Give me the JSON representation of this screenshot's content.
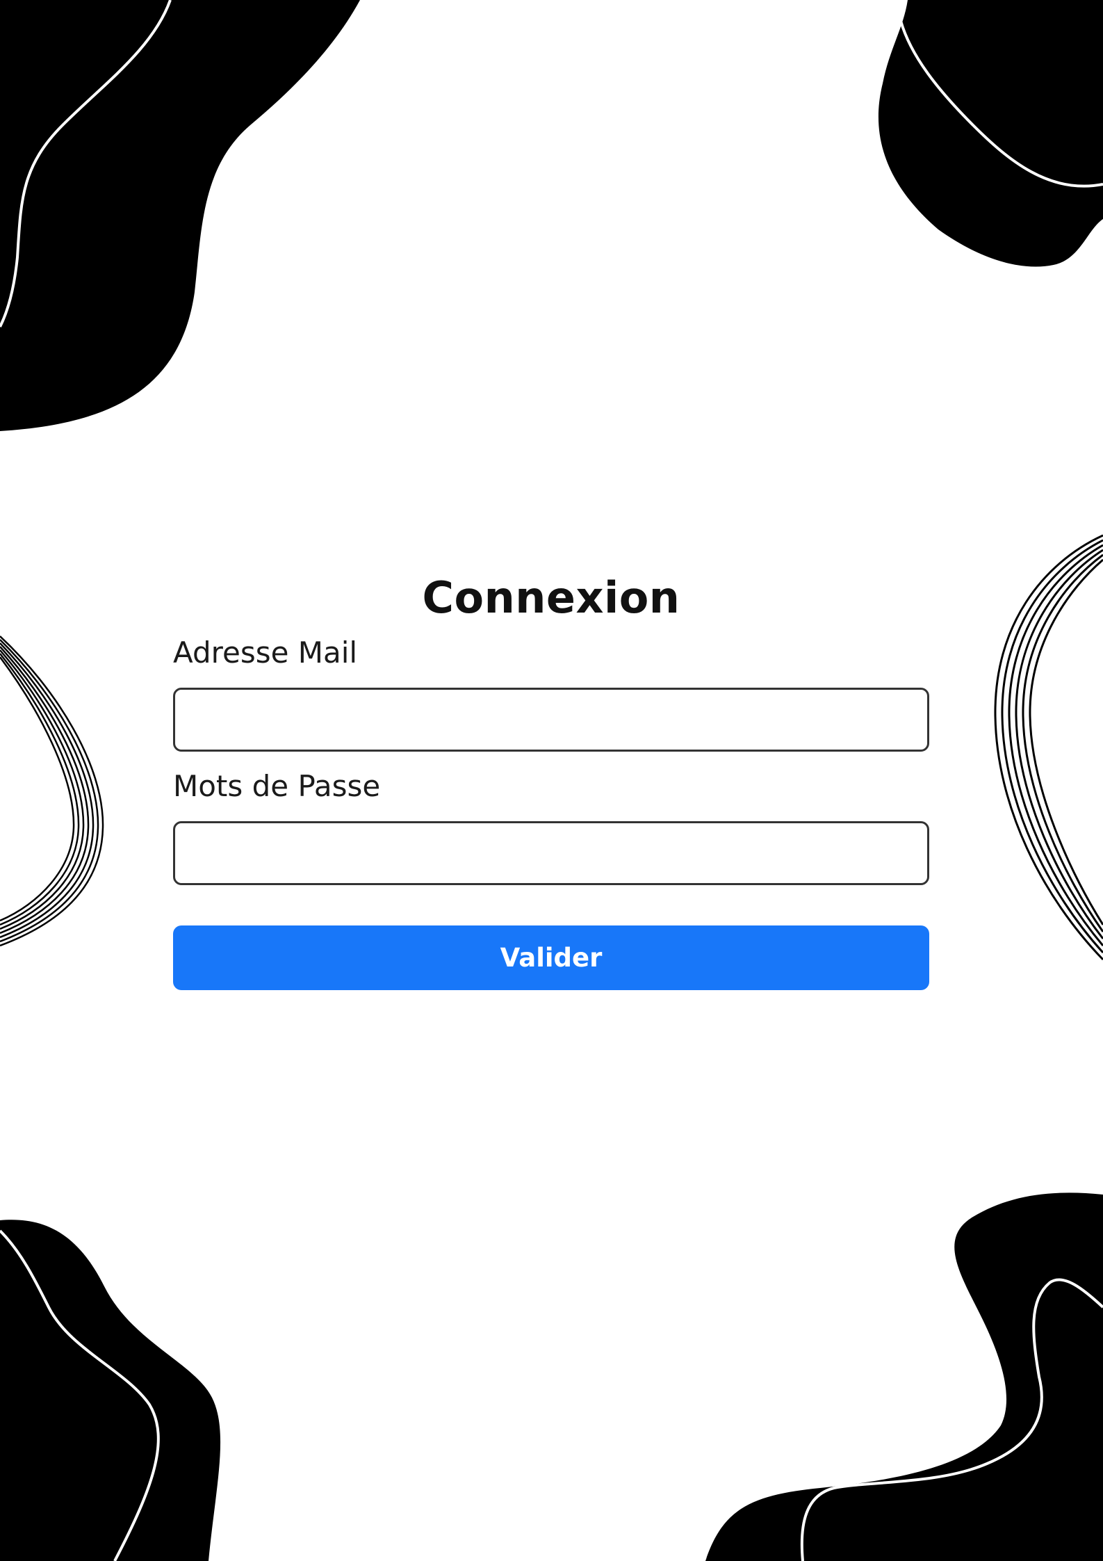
{
  "login": {
    "title": "Connexion",
    "email_label": "Adresse Mail",
    "email_value": "",
    "password_label": "Mots de Passe",
    "password_value": "",
    "submit_label": "Valider"
  },
  "theme": {
    "accent": "#1877f9",
    "shape_color": "#000000",
    "background": "#ffffff"
  }
}
